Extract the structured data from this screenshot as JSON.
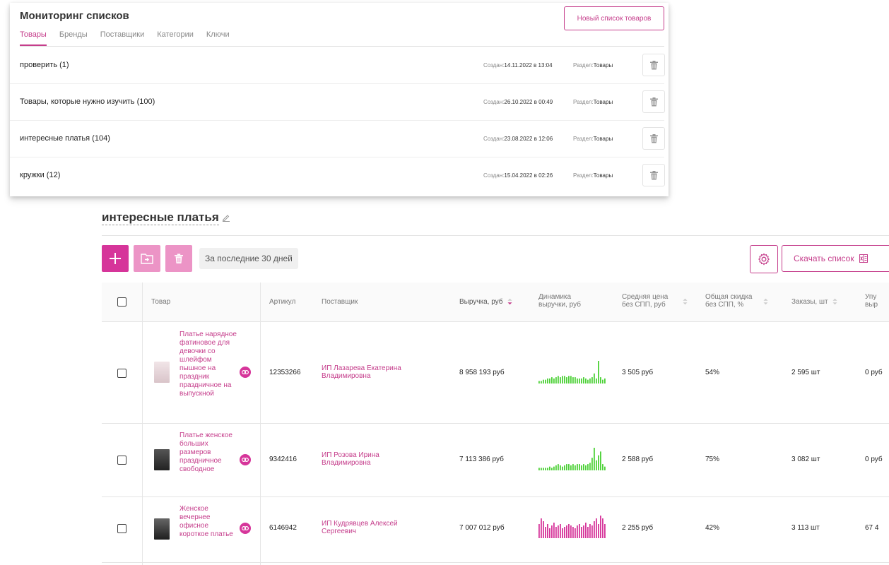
{
  "top": {
    "title": "Мониторинг списков",
    "new_list_button": "Новый список товаров",
    "tabs": [
      "Товары",
      "Бренды",
      "Поставщики",
      "Категории",
      "Ключи"
    ],
    "created_label": "Создан:",
    "section_label": "Раздел:",
    "lists": [
      {
        "name": "проверить (1)",
        "created": "14.11.2022 в 13:04",
        "section": "Товары"
      },
      {
        "name": "Товары, которые нужно изучить (100)",
        "created": "26.10.2022 в 00:49",
        "section": "Товары"
      },
      {
        "name": "интересные платья (104)",
        "created": "23.08.2022 в 12:06",
        "section": "Товары"
      },
      {
        "name": "кружки (12)",
        "created": "15.04.2022 в 02:26",
        "section": "Товары"
      }
    ]
  },
  "list": {
    "title": "интересные платья",
    "period": "За последние 30 дней",
    "download_button": "Скачать список",
    "columns": {
      "product": "Товар",
      "sku": "Артикул",
      "supplier": "Поставщик",
      "revenue": "Выручка, руб",
      "dynamics_1": "Динамика",
      "dynamics_2": "выручки, руб",
      "avg_price_1": "Средняя цена",
      "avg_price_2": "без СПП, руб",
      "discount_1": "Общая скидка",
      "discount_2": "без СПП, %",
      "orders": "Заказы, шт",
      "lost_1": "Упу",
      "lost_2": "выр"
    },
    "rows": [
      {
        "name": "Платье нарядное фатиновое для девочки со шлейфом пышное на праздник праздничное на выпускной",
        "sku": "12353266",
        "supplier": "ИП Лазарева Екатерина Владимировна",
        "revenue": "8 958 193 руб",
        "avg_price": "3 505 руб",
        "discount": "54%",
        "orders": "2 595 шт",
        "lost": "0 руб",
        "spark_color": "#4cd137",
        "spark": [
          2,
          2,
          3,
          3,
          4,
          4,
          5,
          4,
          5,
          6,
          5,
          6,
          6,
          5,
          6,
          6,
          5,
          5,
          4,
          4,
          4,
          5,
          4,
          3,
          4,
          5,
          8,
          4,
          18,
          5,
          3,
          4
        ]
      },
      {
        "name": "Платье женское больших размеров праздничное свободное",
        "sku": "9342416",
        "supplier": "ИП Розова Ирина Владимировна",
        "revenue": "7 113 386 руб",
        "avg_price": "2 588 руб",
        "discount": "75%",
        "orders": "3 082 шт",
        "lost": "0 руб",
        "spark_color": "#4cd137",
        "spark": [
          2,
          2,
          2,
          2,
          2,
          3,
          2,
          3,
          4,
          5,
          4,
          3,
          4,
          5,
          5,
          4,
          5,
          4,
          5,
          5,
          4,
          5,
          4,
          5,
          6,
          10,
          18,
          8,
          12,
          15,
          5,
          3
        ]
      },
      {
        "name": "Женское вечернее офисное короткое платье",
        "sku": "6146942",
        "supplier": "ИП Кудрявцев Алексей Сергеевич",
        "revenue": "7 007 012 руб",
        "avg_price": "2 255 руб",
        "discount": "42%",
        "orders": "3 113 шт",
        "lost": "67 4",
        "spark_color": "#d6359a",
        "spark": [
          10,
          14,
          12,
          8,
          10,
          7,
          9,
          11,
          8,
          9,
          10,
          7,
          8,
          9,
          10,
          9,
          8,
          7,
          9,
          10,
          8,
          9,
          11,
          8,
          10,
          9,
          12,
          14,
          10,
          16,
          14,
          10
        ]
      }
    ]
  }
}
